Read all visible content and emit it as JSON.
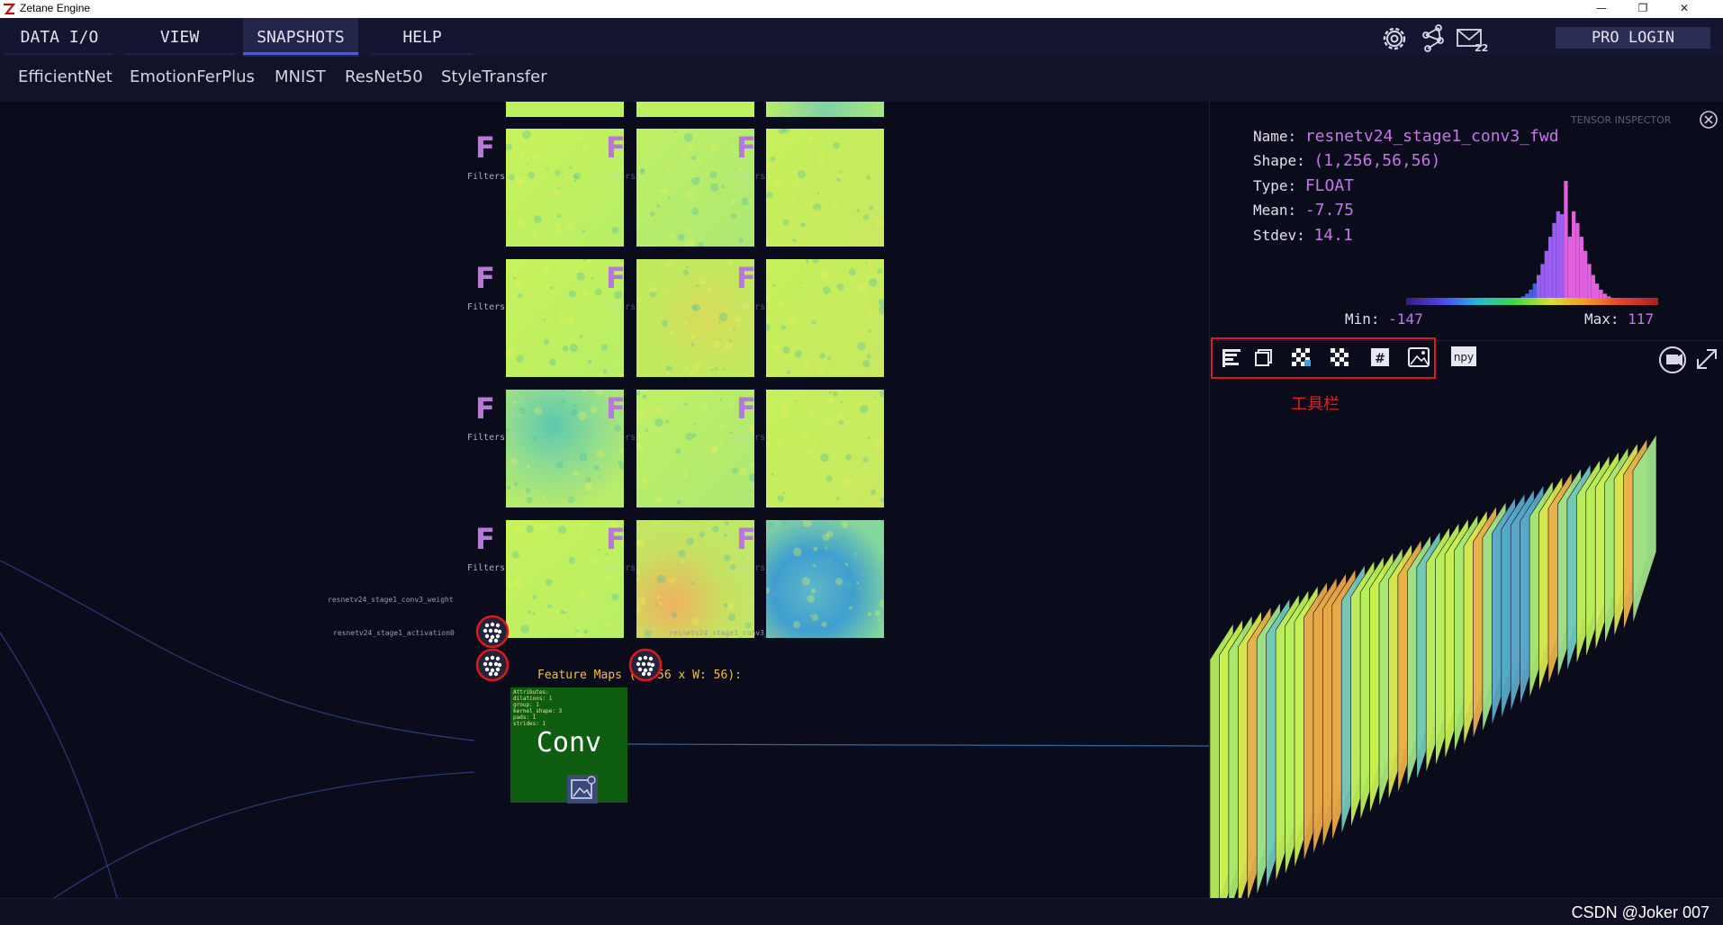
{
  "window": {
    "title": "Zetane Engine",
    "minimize": "—",
    "restore": "❐",
    "close": "✕"
  },
  "menu": [
    {
      "label": "DATA I/O"
    },
    {
      "label": "VIEW"
    },
    {
      "label": "SNAPSHOTS",
      "active": true
    },
    {
      "label": "HELP"
    }
  ],
  "top_icons": [
    "gear-icon",
    "network-graph-icon",
    "mail-icon"
  ],
  "pro_login": "PRO LOGIN",
  "snapshots": [
    "EfficientNet",
    "EmotionFerPlus",
    "MNIST",
    "ResNet50",
    "StyleTransfer"
  ],
  "filters": {
    "icon_glyph": "F",
    "label": "Filters"
  },
  "feature_maps_label": "Feature Maps (H: 56 x W: 56):",
  "node": {
    "title": "Conv",
    "attributes": [
      "Attributes:",
      "  dilations: 1",
      "  group: 1",
      "  kernel_shape: 3",
      "  pads: 1",
      "  strides: 1"
    ],
    "inputs": [
      "resnetv24_stage1_conv3_weight",
      "resnetv24_stage1_activation0"
    ],
    "output": "resnetv24_stage1_conv3_fwd"
  },
  "inspector": {
    "title": "TENSOR INSPECTOR",
    "fields": [
      {
        "key": "Name:",
        "value": "resnetv24_stage1_conv3_fwd"
      },
      {
        "key": "Shape:",
        "value": "(1,256,56,56)"
      },
      {
        "key": "Type:",
        "value": "FLOAT"
      },
      {
        "key": "Mean:",
        "value": "-7.75"
      },
      {
        "key": "Stdev:",
        "value": "14.1"
      }
    ],
    "min_key": "Min:",
    "min_value": "-147",
    "max_key": "Max:",
    "max_value": "117",
    "toolbar_icons": [
      "histogram-icon",
      "layers-icon",
      "checker-icon",
      "checker-alt-icon",
      "hash-icon",
      "image-icon",
      "npy-icon"
    ],
    "toolbar_active": 1,
    "npy_text": "npy",
    "hash_text": "#",
    "toolbar_caption": "工具栏"
  },
  "watermark": "CSDN @Joker 007",
  "colors": {
    "accent_purple": "#c477e9",
    "conv_green": "#0f5d10",
    "highlight_red": "#e01818",
    "feature_label": "#f0c040"
  }
}
